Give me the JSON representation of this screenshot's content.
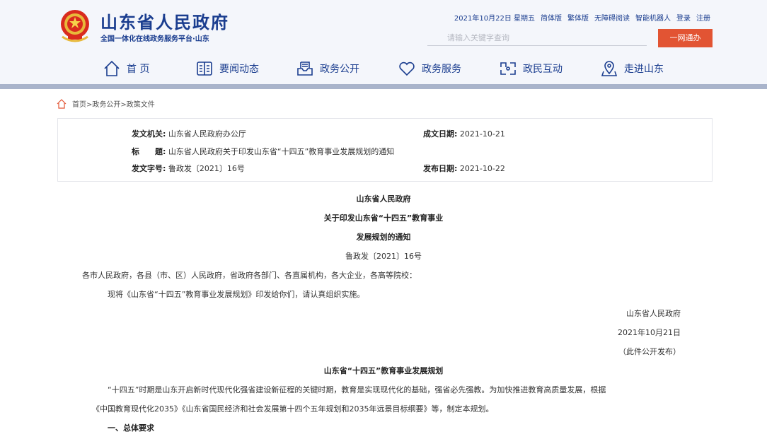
{
  "header": {
    "site_title": "山东省人民政府",
    "site_subtitle": "全国一体化在线政务服务平台·山东",
    "top_links": [
      "2021年10月22日 星期五",
      "简体版",
      "繁体版",
      "无障碍阅读",
      "智能机器人",
      "登录",
      "注册"
    ],
    "search_placeholder": "请输入关键字查询",
    "login_button": "一网通办",
    "accent_color": "#1a3d8f",
    "button_color": "#e25433"
  },
  "nav": {
    "items": [
      {
        "label": "首 页",
        "icon": "home-icon"
      },
      {
        "label": "要闻动态",
        "icon": "book-icon"
      },
      {
        "label": "政务公开",
        "icon": "inbox-icon"
      },
      {
        "label": "政务服务",
        "icon": "heart-icon"
      },
      {
        "label": "政民互动",
        "icon": "interact-icon"
      },
      {
        "label": "走进山东",
        "icon": "location-icon"
      }
    ]
  },
  "breadcrumb": "首页>政务公开>政策文件",
  "info": {
    "issuer_label": "发文机关:",
    "issuer": "山东省人民政府办公厅",
    "created_label": "成文日期:",
    "created": "2021-10-21",
    "title_label": "标　　题:",
    "title": "山东省人民政府关于印发山东省“十四五”教育事业发展规划的通知",
    "docno_label": "发文字号:",
    "docno": "鲁政发〔2021〕16号",
    "published_label": "发布日期:",
    "published": "2021-10-22"
  },
  "article": {
    "issuer": "山东省人民政府",
    "heading_1": "关于印发山东省“十四五”教育事业",
    "heading_2": "发展规划的通知",
    "docno": "鲁政发〔2021〕16号",
    "recipients": "各市人民政府，各县（市、区）人民政府，省政府各部门、各直属机构，各大企业，各高等院校：",
    "body": "现将《山东省“十四五”教育事业发展规划》印发给你们，请认真组织实施。",
    "sign_org": "山东省人民政府",
    "sign_date": "2021年10月21日",
    "sign_note": "（此件公开发布）",
    "plan_title": "山东省“十四五”教育事业发展规划",
    "para_1": "“十四五”时期是山东开启新时代现代化强省建设新征程的关键时期，教育是实现现代化的基础，强省必先强教。为加快推进教育高质量发展，根据",
    "para_2": "《中国教育现代化2035》《山东省国民经济和社会发展第十四个五年规划和2035年远景目标纲要》等，制定本规划。",
    "section_1": "一、总体要求"
  }
}
